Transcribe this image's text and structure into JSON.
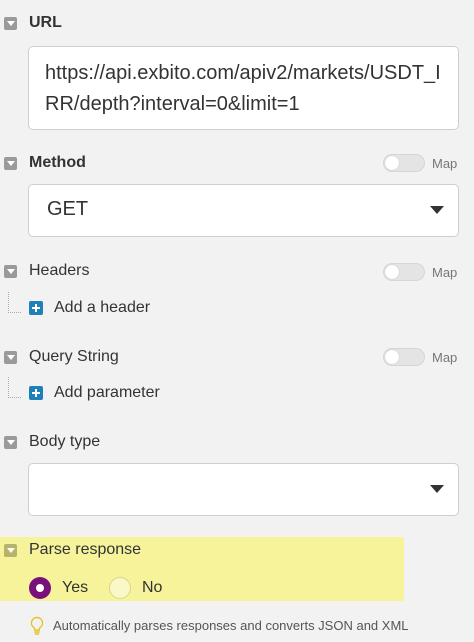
{
  "url": {
    "label": "URL",
    "value": "https://api.exbito.com/apiv2/markets/USDT_IRR/depth?interval=0&limit=1"
  },
  "method": {
    "label": "Method",
    "value": "GET",
    "map_label": "Map",
    "map_on": false
  },
  "headers": {
    "label": "Headers",
    "map_label": "Map",
    "add_label": "Add a header"
  },
  "query_string": {
    "label": "Query String",
    "map_label": "Map",
    "add_label": "Add parameter"
  },
  "body_type": {
    "label": "Body type",
    "value": ""
  },
  "parse_response": {
    "label": "Parse response",
    "options": [
      {
        "label": "Yes",
        "selected": true
      },
      {
        "label": "No",
        "selected": false
      }
    ],
    "hint": "Automatically parses responses and converts JSON and XML"
  },
  "colors": {
    "highlight": "#f6f39a",
    "radio_selected": "#7a117a",
    "plus_button": "#1f7fb8"
  }
}
